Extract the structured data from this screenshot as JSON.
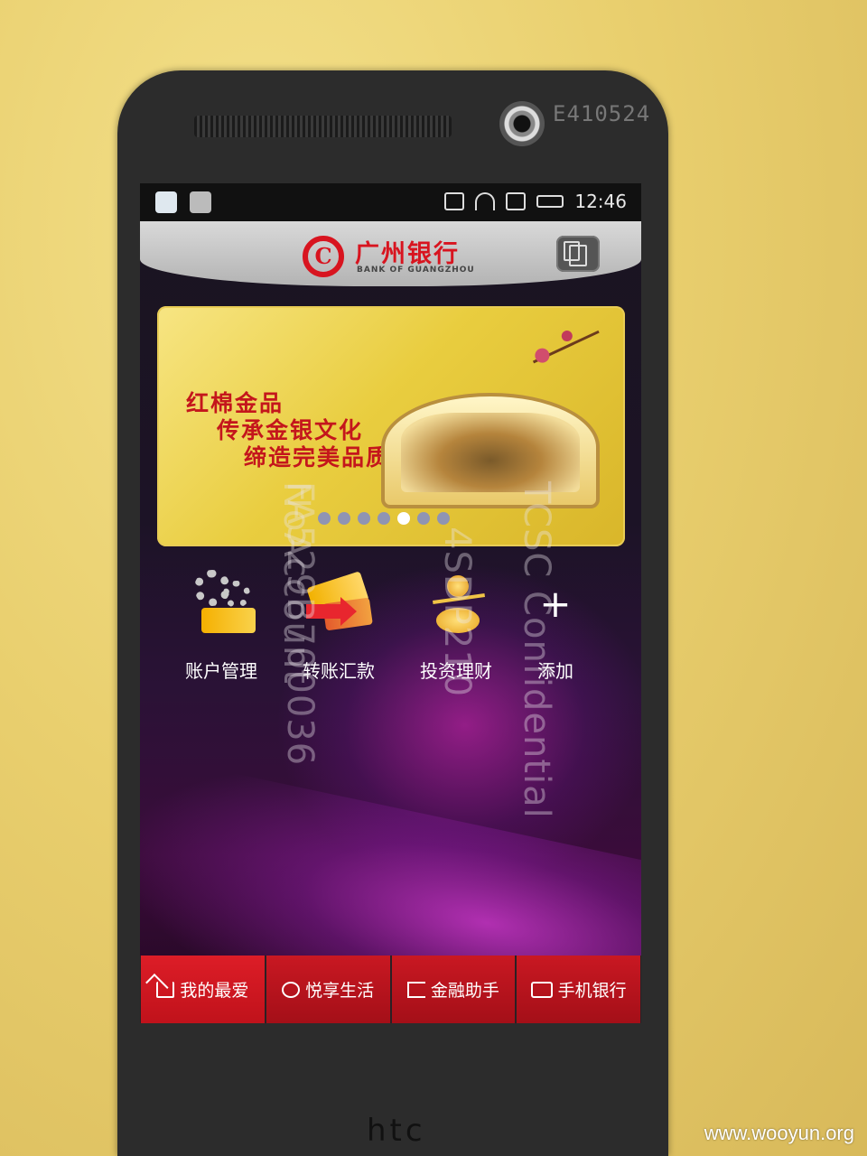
{
  "device": {
    "serial": "E410524",
    "brand": "htc"
  },
  "statusbar": {
    "time": "12:46"
  },
  "header": {
    "bank_name": "广州银行",
    "bank_name_en": "BANK OF GUANGZHOU"
  },
  "banner": {
    "lines": [
      "红棉金品",
      "传承金银文化",
      "缔造完美品质"
    ],
    "dot_count": 7,
    "active_dot": 4
  },
  "shortcuts": [
    {
      "label": "账户管理",
      "icon": "account-gears-icon"
    },
    {
      "label": "转账汇款",
      "icon": "transfer-cards-icon"
    },
    {
      "label": "投资理财",
      "icon": "investment-scale-icon"
    },
    {
      "label": "添加",
      "icon": "plus-icon"
    }
  ],
  "watermark": {
    "lines": [
      "FA529B700036",
      "NoAccount",
      "4SDP210",
      "TCSC Confidential"
    ]
  },
  "tabbar": [
    {
      "label": "我的最爱",
      "icon": "home-icon",
      "active": true
    },
    {
      "label": "悦享生活",
      "icon": "life-icon",
      "active": false
    },
    {
      "label": "金融助手",
      "icon": "assistant-icon",
      "active": false
    },
    {
      "label": "手机银行",
      "icon": "mail-icon",
      "active": false
    }
  ],
  "footer": {
    "site": "www.wooyun.org"
  },
  "colors": {
    "brand_red": "#d8141f",
    "tab_red": "#c91822"
  }
}
